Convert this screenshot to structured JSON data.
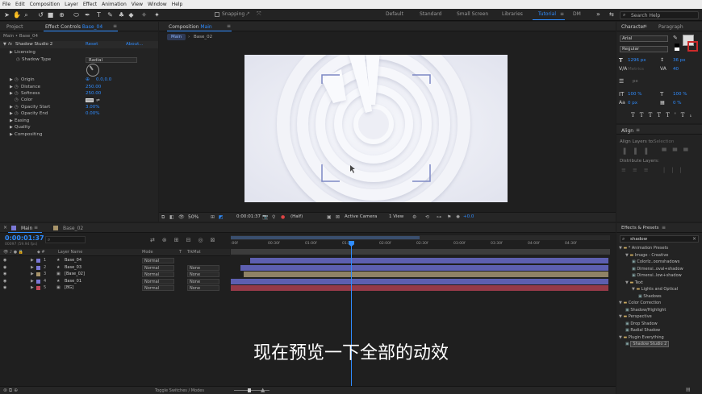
{
  "menu": [
    "File",
    "Edit",
    "Composition",
    "Layer",
    "Effect",
    "Animation",
    "View",
    "Window",
    "Help"
  ],
  "toolbar": {
    "snapping_label": "Snapping",
    "workspaces": [
      "Default",
      "Standard",
      "Small Screen",
      "Libraries",
      "Tutorial",
      "DM"
    ],
    "active_workspace": "Tutorial",
    "search_help": "Search Help"
  },
  "left_panel": {
    "tab_project": "Project",
    "tab_effect_controls": "Effect Controls",
    "effect_layer": "Base_04",
    "breadcrumb": "Main • Base_04",
    "effect_name": "Shadow Studio 2",
    "reset": "Reset",
    "about": "About...",
    "params": [
      {
        "label": "Licensing",
        "value": ""
      },
      {
        "label": "Shadow Type",
        "value": "Radial"
      },
      {
        "label": "Origin",
        "value": "0.0,0.0"
      },
      {
        "label": "Distance",
        "value": "250.00"
      },
      {
        "label": "Softness",
        "value": "250.00"
      },
      {
        "label": "Color",
        "value": ""
      },
      {
        "label": "Opacity Start",
        "value": "3.00%"
      },
      {
        "label": "Opacity End",
        "value": "0.00%"
      },
      {
        "label": "Easing",
        "value": ""
      },
      {
        "label": "Quality",
        "value": ""
      },
      {
        "label": "Compositing",
        "value": ""
      }
    ]
  },
  "composition": {
    "tab_label": "Composition",
    "comp_name": "Main",
    "nav_main": "Main",
    "nav_layer": "Base_02",
    "zoom": "50%",
    "timecode": "0:00:01:37",
    "resolution": "(Half)",
    "camera": "Active Camera",
    "views": "1 View",
    "exposure": "+0.0"
  },
  "character": {
    "tab_character": "Character",
    "tab_paragraph": "Paragraph",
    "font": "Arial",
    "style": "Regular",
    "size": "1296 px",
    "leading": "36 px",
    "kerning": "Metrics",
    "tracking": "40",
    "stroke": "px",
    "vscale": "100 %",
    "hscale": "100 %",
    "baseline": "0 px",
    "tsume": "0 %"
  },
  "align": {
    "tab": "Align",
    "align_to_label": "Align Layers to:",
    "align_to_value": "Selection",
    "distribute_label": "Distribute Layers:"
  },
  "effects_presets": {
    "tab": "Effects & Presets",
    "search": "shadow",
    "tree": [
      {
        "label": "* Animation Presets",
        "level": 0,
        "type": "folder"
      },
      {
        "label": "Image - Creative",
        "level": 1,
        "type": "folder"
      },
      {
        "label": "Colorlz..oomshadows",
        "level": 2,
        "type": "item"
      },
      {
        "label": "Dimensi..oval+shadow",
        "level": 2,
        "type": "item"
      },
      {
        "label": "Dimensi..low+shadow",
        "level": 2,
        "type": "item"
      },
      {
        "label": "Text",
        "level": 1,
        "type": "folder"
      },
      {
        "label": "Lights and Optical",
        "level": 2,
        "type": "folder"
      },
      {
        "label": "Shadows",
        "level": 3,
        "type": "item"
      },
      {
        "label": "Color Correction",
        "level": 0,
        "type": "folder"
      },
      {
        "label": "Shadow/Highlight",
        "level": 1,
        "type": "item"
      },
      {
        "label": "Perspective",
        "level": 0,
        "type": "folder"
      },
      {
        "label": "Drop Shadow",
        "level": 1,
        "type": "item"
      },
      {
        "label": "Radial Shadow",
        "level": 1,
        "type": "item"
      },
      {
        "label": "Plugin Everything",
        "level": 0,
        "type": "folder"
      },
      {
        "label": "Shadow Studio 2",
        "level": 1,
        "type": "item",
        "selected": true
      }
    ]
  },
  "timeline": {
    "tab_main": "Main",
    "tab_base": "Base_02",
    "timecode": "0:00:01:37",
    "frame_sub": "00097 (59.94 fps)",
    "col_layer_name": "Layer Name",
    "col_mode": "Mode",
    "col_t": "T",
    "col_trkmat": "TrkMat",
    "ruler": [
      ":00f",
      "00:30f",
      "01:00f",
      "01:30f",
      "02:00f",
      "02:30f",
      "03:00f",
      "03:30f",
      "04:00f",
      "04:30f"
    ],
    "layers": [
      {
        "num": "1",
        "name": "Base_04",
        "mode": "Normal",
        "trkmat": "",
        "color": "#7b78d6",
        "bar": "#5d5fb0"
      },
      {
        "num": "2",
        "name": "Base_03",
        "mode": "Normal",
        "trkmat": "None",
        "color": "#7b78d6",
        "bar": "#5d5fb0"
      },
      {
        "num": "3",
        "name": "[Base_02]",
        "mode": "Normal",
        "trkmat": "None",
        "color": "#a8946a",
        "bar": "#8f8266"
      },
      {
        "num": "4",
        "name": "Base_01",
        "mode": "Normal",
        "trkmat": "None",
        "color": "#7b78d6",
        "bar": "#5d5fb0"
      },
      {
        "num": "5",
        "name": "[BG]",
        "mode": "Normal",
        "trkmat": "None",
        "color": "#c24a5a",
        "bar": "#953a48"
      }
    ],
    "toggle_label": "Toggle Switches / Modes"
  },
  "subtitle": "现在预览一下全部的动效",
  "colors": {
    "accent": "#2f8cff",
    "bg": "#1d1d1d",
    "panel": "#232323"
  }
}
